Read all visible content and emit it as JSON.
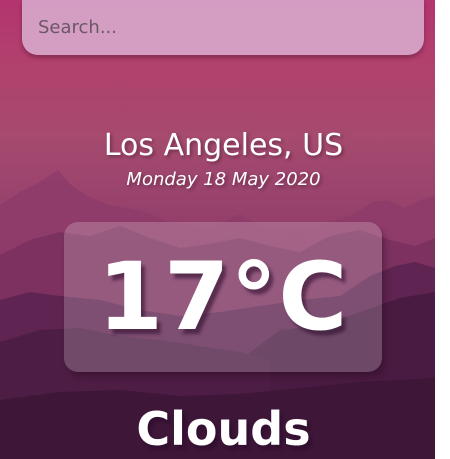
{
  "search": {
    "placeholder": "Search...",
    "value": ""
  },
  "location": {
    "city": "Los Angeles, US",
    "date": "Monday 18 May 2020"
  },
  "weather": {
    "temperature": "17°C",
    "condition": "Clouds"
  },
  "background": {
    "theme": "purple-mountains",
    "colors": [
      "#b3346f",
      "#94406b",
      "#6e2c5b",
      "#3a1535"
    ]
  },
  "icons": {
    "background_art": "mountain-landscape"
  }
}
